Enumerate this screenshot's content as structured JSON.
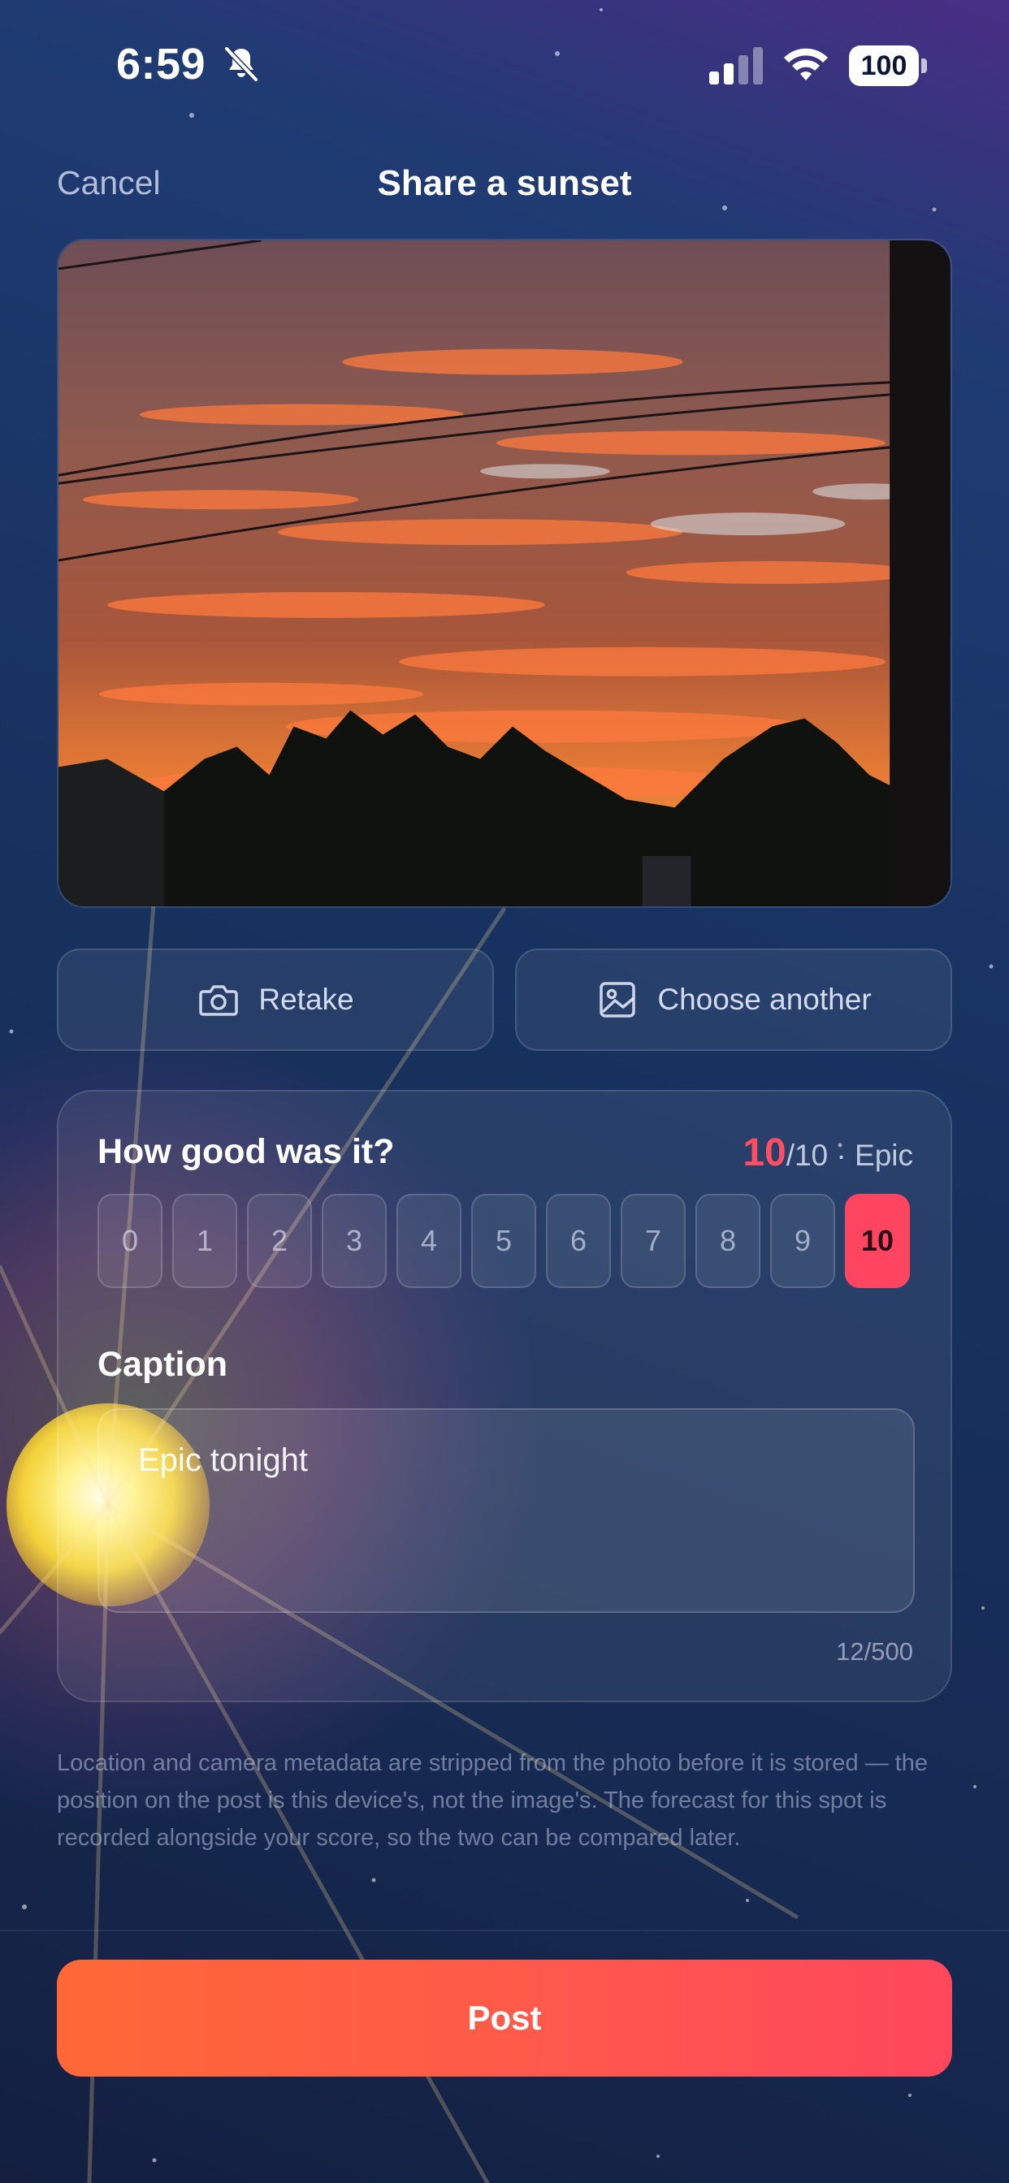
{
  "status_bar": {
    "time": "6:59",
    "battery": "100"
  },
  "nav": {
    "cancel_label": "Cancel",
    "title": "Share a sunset"
  },
  "actions": {
    "retake_label": "Retake",
    "choose_label": "Choose another"
  },
  "rating": {
    "question": "How good was it?",
    "score": "10",
    "score_suffix": "/10 · Epic",
    "options": [
      "0",
      "1",
      "2",
      "3",
      "4",
      "5",
      "6",
      "7",
      "8",
      "9",
      "10"
    ],
    "selected": "10"
  },
  "caption": {
    "label": "Caption",
    "value": "Epic tonight",
    "counter": "12/500"
  },
  "info_text": "Location and camera metadata are stripped from the photo before it is stored — the position on the post is this device's, not the image's. The forecast for this spot is recorded alongside your score, so the two can be compared later.",
  "post_label": "Post",
  "colors": {
    "accent": "#ff4560",
    "post_start": "#ff6836",
    "post_end": "#ff475c"
  }
}
